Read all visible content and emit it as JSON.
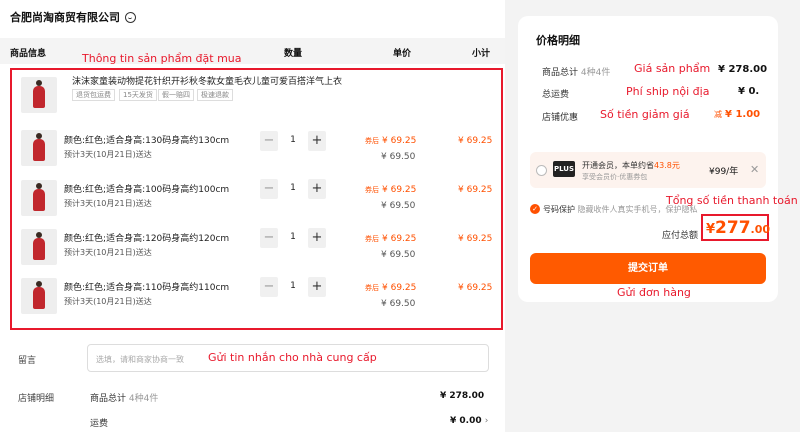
{
  "shop": {
    "name": "合肥尚淘商贸有限公司"
  },
  "table_header": {
    "info": "商品信息",
    "qty": "数量",
    "price": "单价",
    "subtotal": "小计"
  },
  "annotations": {
    "product_info": "Thông tin sản phẩm đặt mua",
    "product_price": "Giá sản phẩm",
    "domestic_ship": "Phí ship nội địa",
    "discount": "Số tiền giảm giá",
    "total_payment": "Tổng số tiền thanh toán",
    "submit_order": "Gửi đơn hàng",
    "message_supplier": "Gửi tin nhắn cho nhà cung cấp"
  },
  "product": {
    "title": "沫沫家童装动物提花针织开衫秋冬款女童毛衣儿童可爱百搭洋气上衣",
    "tags": [
      "退货包运费",
      "15天发货",
      "假一赔四",
      "极速退款"
    ]
  },
  "items": [
    {
      "variant": "颜色:红色;适合身高:130码身高约130cm",
      "delivery": "预计3天(10月21日)送达",
      "qty": "1",
      "promo_label": "券后",
      "promo_price": "¥ 69.25",
      "orig_price": "¥ 69.50",
      "subtotal": "¥ 69.25"
    },
    {
      "variant": "颜色:红色;适合身高:100码身高约100cm",
      "delivery": "预计3天(10月21日)送达",
      "qty": "1",
      "promo_label": "券后",
      "promo_price": "¥ 69.25",
      "orig_price": "¥ 69.50",
      "subtotal": "¥ 69.25"
    },
    {
      "variant": "颜色:红色;适合身高:120码身高约120cm",
      "delivery": "预计3天(10月21日)送达",
      "qty": "1",
      "promo_label": "券后",
      "promo_price": "¥ 69.25",
      "orig_price": "¥ 69.50",
      "subtotal": "¥ 69.25"
    },
    {
      "variant": "颜色:红色;适合身高:110码身高约110cm",
      "delivery": "预计3天(10月21日)送达",
      "qty": "1",
      "promo_label": "券后",
      "promo_price": "¥ 69.25",
      "orig_price": "¥ 69.50",
      "subtotal": "¥ 69.25"
    }
  ],
  "message": {
    "label": "留言",
    "placeholder": "选填，请和商家协商一致"
  },
  "shop_detail": {
    "label": "店铺明细",
    "goods_total_label": "商品总计",
    "goods_total_count": "4种4件",
    "goods_total_value": "¥ 278.00",
    "shipping_label": "运费",
    "shipping_value": "¥ 0.00"
  },
  "price_panel": {
    "title": "价格明细",
    "goods_total_label": "商品总计",
    "goods_total_count": "4种4件",
    "goods_total_value": "¥ 278.00",
    "shipping_label": "总运费",
    "shipping_value": "¥ 0.",
    "discount_label": "店铺优惠",
    "discount_prefix": "减",
    "discount_value": "¥ 1.00"
  },
  "plus": {
    "badge": "PLUS",
    "text_pre": "开通会员，本单约省",
    "text_amount": "43.8元",
    "subtext": "享受会员价·优惠券包",
    "price": "¥99/年"
  },
  "number_protect": {
    "label": "号码保护",
    "desc": "隐藏收件人真实手机号，保护隐私"
  },
  "payment": {
    "label": "应付总额",
    "yen": "¥",
    "int": "277",
    "dec": ".00"
  },
  "submit": {
    "label": "提交订单"
  },
  "colors": {
    "accent": "#ff5000",
    "annotation": "#e8192c"
  }
}
